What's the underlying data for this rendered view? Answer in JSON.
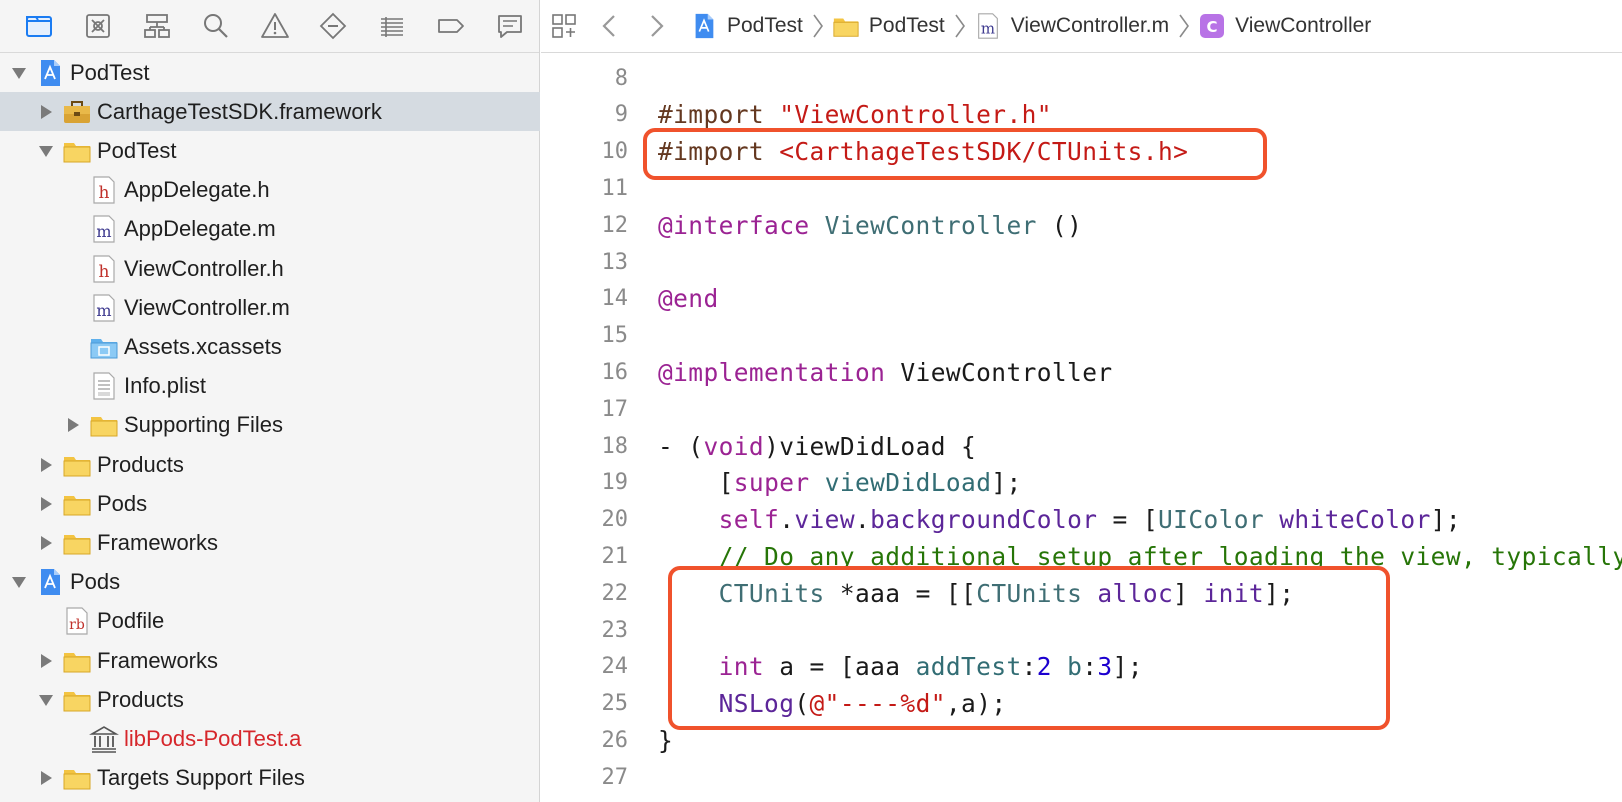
{
  "navigator": {
    "tools": [
      "folder-icon",
      "source-control-icon",
      "hierarchy-icon",
      "search-icon",
      "warning-icon",
      "test-icon",
      "debug-icon",
      "breakpoint-icon",
      "report-icon"
    ],
    "tree": [
      {
        "label": "PodTest",
        "depth": 0,
        "expanded": true,
        "disclosure": true,
        "icon": "xcode-project-icon"
      },
      {
        "label": "CarthageTestSDK.framework",
        "depth": 1,
        "expanded": false,
        "disclosure": true,
        "icon": "framework-icon",
        "selected": true
      },
      {
        "label": "PodTest",
        "depth": 1,
        "expanded": true,
        "disclosure": true,
        "icon": "folder-icon"
      },
      {
        "label": "AppDelegate.h",
        "depth": 2,
        "disclosure": false,
        "icon": "header-file-icon"
      },
      {
        "label": "AppDelegate.m",
        "depth": 2,
        "disclosure": false,
        "icon": "implementation-file-icon"
      },
      {
        "label": "ViewController.h",
        "depth": 2,
        "disclosure": false,
        "icon": "header-file-icon"
      },
      {
        "label": "ViewController.m",
        "depth": 2,
        "disclosure": false,
        "icon": "implementation-file-icon"
      },
      {
        "label": "Assets.xcassets",
        "depth": 2,
        "disclosure": false,
        "icon": "asset-catalog-icon"
      },
      {
        "label": "Info.plist",
        "depth": 2,
        "disclosure": false,
        "icon": "plist-file-icon"
      },
      {
        "label": "Supporting Files",
        "depth": 2,
        "expanded": false,
        "disclosure": true,
        "icon": "folder-icon"
      },
      {
        "label": "Products",
        "depth": 1,
        "expanded": false,
        "disclosure": true,
        "icon": "folder-icon"
      },
      {
        "label": "Pods",
        "depth": 1,
        "expanded": false,
        "disclosure": true,
        "icon": "folder-icon"
      },
      {
        "label": "Frameworks",
        "depth": 1,
        "expanded": false,
        "disclosure": true,
        "icon": "folder-icon"
      },
      {
        "label": "Pods",
        "depth": 0,
        "expanded": true,
        "disclosure": true,
        "icon": "xcode-project-icon"
      },
      {
        "label": "Podfile",
        "depth": 1,
        "disclosure": false,
        "icon": "ruby-file-icon"
      },
      {
        "label": "Frameworks",
        "depth": 1,
        "expanded": false,
        "disclosure": true,
        "icon": "folder-icon"
      },
      {
        "label": "Products",
        "depth": 1,
        "expanded": true,
        "disclosure": true,
        "icon": "folder-icon"
      },
      {
        "label": "libPods-PodTest.a",
        "depth": 2,
        "disclosure": false,
        "icon": "library-icon",
        "missing": true
      },
      {
        "label": "Targets Support Files",
        "depth": 1,
        "expanded": false,
        "disclosure": true,
        "icon": "folder-icon"
      }
    ]
  },
  "jumpbar": {
    "breadcrumbs": [
      {
        "label": "PodTest",
        "icon": "xcode-project-icon"
      },
      {
        "label": "PodTest",
        "icon": "folder-icon"
      },
      {
        "label": "ViewController.m",
        "icon": "implementation-file-icon"
      },
      {
        "label": "ViewController",
        "icon": "class-icon"
      }
    ]
  },
  "editor": {
    "lines": [
      {
        "n": "8",
        "tokens": []
      },
      {
        "n": "9",
        "tokens": [
          [
            "dir",
            "#import "
          ],
          [
            "str",
            "\"ViewController.h\""
          ]
        ]
      },
      {
        "n": "10",
        "tokens": [
          [
            "dir",
            "#import "
          ],
          [
            "str",
            "<CarthageTestSDK/CTUnits.h>"
          ]
        ]
      },
      {
        "n": "11",
        "tokens": []
      },
      {
        "n": "12",
        "tokens": [
          [
            "kw",
            "@interface "
          ],
          [
            "typ",
            "ViewController"
          ],
          [
            "",
            " ()"
          ]
        ]
      },
      {
        "n": "13",
        "tokens": []
      },
      {
        "n": "14",
        "tokens": [
          [
            "kw",
            "@end"
          ]
        ]
      },
      {
        "n": "15",
        "tokens": []
      },
      {
        "n": "16",
        "tokens": [
          [
            "kw",
            "@implementation "
          ],
          [
            "",
            "ViewController"
          ]
        ]
      },
      {
        "n": "17",
        "tokens": []
      },
      {
        "n": "18",
        "tokens": [
          [
            "",
            "- ("
          ],
          [
            "kw",
            "void"
          ],
          [
            "",
            ")viewDidLoad {"
          ]
        ]
      },
      {
        "n": "19",
        "tokens": [
          [
            "",
            "    ["
          ],
          [
            "kw",
            "super"
          ],
          [
            "",
            " "
          ],
          [
            "mth",
            "viewDidLoad"
          ],
          [
            "",
            "];"
          ]
        ]
      },
      {
        "n": "20",
        "tokens": [
          [
            "",
            "    "
          ],
          [
            "kw",
            "self"
          ],
          [
            "",
            "."
          ],
          [
            "sys",
            "view"
          ],
          [
            "",
            "."
          ],
          [
            "sys",
            "backgroundColor"
          ],
          [
            "",
            " = ["
          ],
          [
            "typ",
            "UIColor"
          ],
          [
            "",
            " "
          ],
          [
            "sys",
            "whiteColor"
          ],
          [
            "",
            "];"
          ]
        ]
      },
      {
        "n": "21",
        "tokens": [
          [
            "",
            "    "
          ],
          [
            "cmt",
            "// Do any additional setup after loading the view, typically from a nib."
          ]
        ]
      },
      {
        "n": "22",
        "tokens": [
          [
            "",
            "    "
          ],
          [
            "typ",
            "CTUnits"
          ],
          [
            "",
            " *aaa = [["
          ],
          [
            "typ",
            "CTUnits"
          ],
          [
            "",
            " "
          ],
          [
            "sys",
            "alloc"
          ],
          [
            "",
            "] "
          ],
          [
            "sys",
            "init"
          ],
          [
            "",
            "];"
          ]
        ]
      },
      {
        "n": "23",
        "tokens": []
      },
      {
        "n": "24",
        "tokens": [
          [
            "",
            "    "
          ],
          [
            "kw",
            "int"
          ],
          [
            "",
            " a = [aaa "
          ],
          [
            "mth",
            "addTest"
          ],
          [
            "",
            ":"
          ],
          [
            "num",
            "2"
          ],
          [
            "",
            " "
          ],
          [
            "mth",
            "b"
          ],
          [
            "",
            ":"
          ],
          [
            "num",
            "3"
          ],
          [
            "",
            "];"
          ]
        ]
      },
      {
        "n": "25",
        "tokens": [
          [
            "",
            "    "
          ],
          [
            "sys",
            "NSLog"
          ],
          [
            "",
            "("
          ],
          [
            "str",
            "@\"----%d\""
          ],
          [
            "",
            ",a);"
          ]
        ]
      },
      {
        "n": "26",
        "tokens": [
          [
            "",
            "}"
          ]
        ]
      },
      {
        "n": "27",
        "tokens": []
      }
    ]
  },
  "colors": {
    "highlight_box": "#f0522c",
    "selection": "#d5dbe1",
    "folder": "#f5c842",
    "accent": "#1b7cf2"
  }
}
